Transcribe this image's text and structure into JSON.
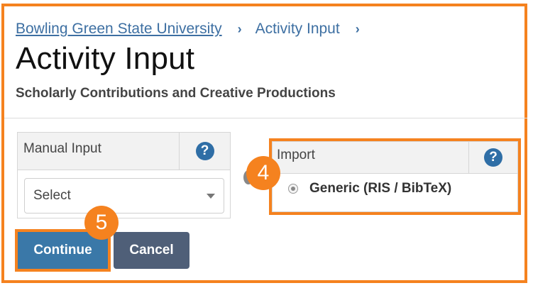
{
  "breadcrumb": {
    "items": [
      "Bowling Green State University",
      "Activity Input"
    ],
    "separator": "›"
  },
  "page": {
    "title": "Activity Input",
    "subtitle": "Scholarly Contributions and Creative Productions"
  },
  "manual_panel": {
    "label": "Manual Input",
    "help_icon": "?",
    "select": {
      "value": "Select"
    }
  },
  "import_panel": {
    "label": "Import",
    "help_icon": "?",
    "options": [
      {
        "label": "Generic (RIS / BibTeX)",
        "selected": false
      }
    ]
  },
  "buttons": {
    "continue": "Continue",
    "cancel": "Cancel"
  },
  "badges": {
    "step4": "4",
    "step5": "5"
  },
  "colors": {
    "highlight": "#f5821f",
    "link": "#3d6fa2",
    "primary_button": "#3a78a8",
    "cancel_button": "#4f5f78",
    "help_icon": "#2f6ea6"
  }
}
